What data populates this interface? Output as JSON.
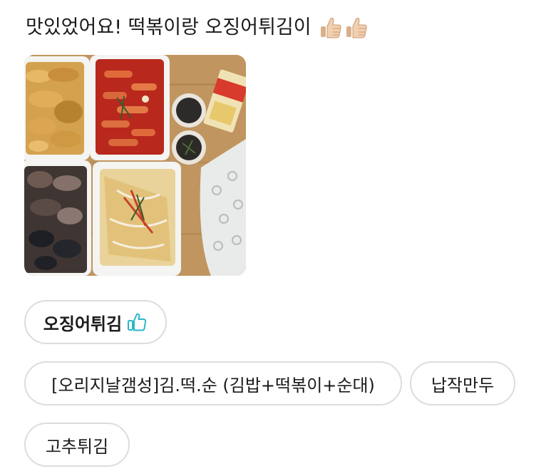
{
  "review": {
    "text": "맛있었어요! 떡볶이랑 오징어튀김이",
    "emoji": [
      "thumbs-up-icon",
      "thumbs-up-icon"
    ]
  },
  "photo": {
    "subject": "food-photo"
  },
  "best_menu": {
    "label": "오징어튀김",
    "icon": "thumbs-up-outline-icon",
    "icon_color": "#2bb7c9"
  },
  "menu_tags": [
    "[오리지날갬성]김.떡.순 (김밥+떡볶이+순대)",
    "납작만두",
    "고추튀김"
  ],
  "colors": {
    "chip_border": "#dcdcdc",
    "text": "#1a1a1a",
    "accent": "#2bb7c9"
  }
}
